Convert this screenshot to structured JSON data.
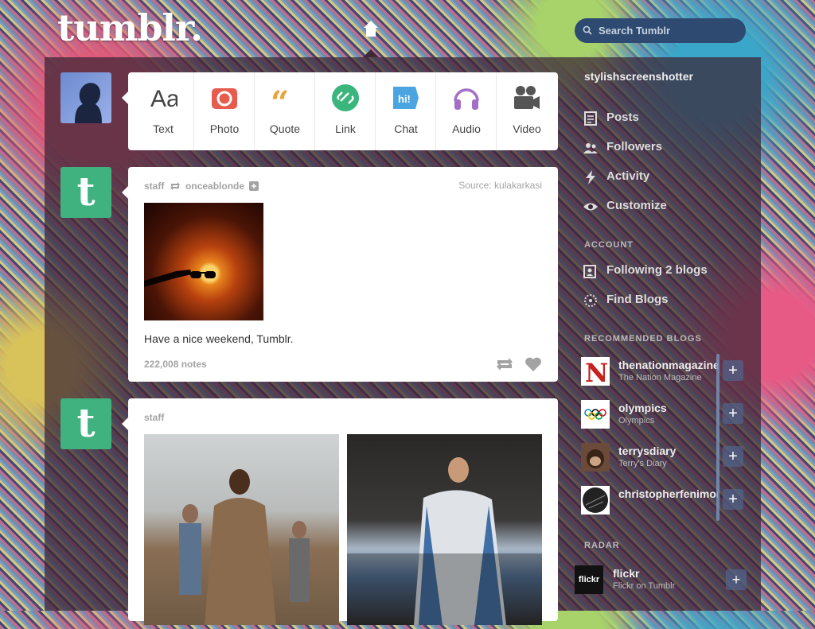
{
  "header": {
    "logo": "tumblr.",
    "search_placeholder": "Search Tumblr"
  },
  "composer": {
    "types": [
      {
        "label": "Text",
        "icon": "text-icon",
        "color": "#444444"
      },
      {
        "label": "Photo",
        "icon": "camera-icon",
        "color": "#e65c4f"
      },
      {
        "label": "Quote",
        "icon": "quote-icon",
        "color": "#e9a33b"
      },
      {
        "label": "Link",
        "icon": "link-icon",
        "color": "#3ab57c"
      },
      {
        "label": "Chat",
        "icon": "chat-icon",
        "color": "#4ba5e0"
      },
      {
        "label": "Audio",
        "icon": "headphones-icon",
        "color": "#a46fc7"
      },
      {
        "label": "Video",
        "icon": "video-camera-icon",
        "color": "#555555"
      }
    ]
  },
  "posts": [
    {
      "author": "staff",
      "reblogged_from": "onceablonde",
      "source_label": "Source:",
      "source_value": "kulakarkasi",
      "caption": "Have a nice weekend, Tumblr.",
      "notes": "222,008 notes"
    },
    {
      "author": "staff"
    }
  ],
  "sidebar": {
    "blog_name": "stylishscreenshotter",
    "items": [
      {
        "label": "Posts",
        "icon": "posts-icon"
      },
      {
        "label": "Followers",
        "icon": "followers-icon"
      },
      {
        "label": "Activity",
        "icon": "lightning-icon"
      },
      {
        "label": "Customize",
        "icon": "eye-icon"
      }
    ],
    "account_heading": "ACCOUNT",
    "account_items": [
      {
        "label": "Following 2 blogs",
        "icon": "following-icon"
      },
      {
        "label": "Find Blogs",
        "icon": "find-blogs-icon"
      }
    ],
    "recommended_heading": "RECOMMENDED BLOGS",
    "recommended": [
      {
        "name": "thenationmagazine",
        "sub": "The Nation Magazine"
      },
      {
        "name": "olympics",
        "sub": "Olympics"
      },
      {
        "name": "terrysdiary",
        "sub": "Terry's Diary"
      },
      {
        "name": "christopherfenimore",
        "sub": ""
      }
    ],
    "radar_heading": "RADAR",
    "radar": {
      "name": "flickr",
      "sub": "Flickr on Tumblr",
      "badge": "flickr"
    }
  }
}
